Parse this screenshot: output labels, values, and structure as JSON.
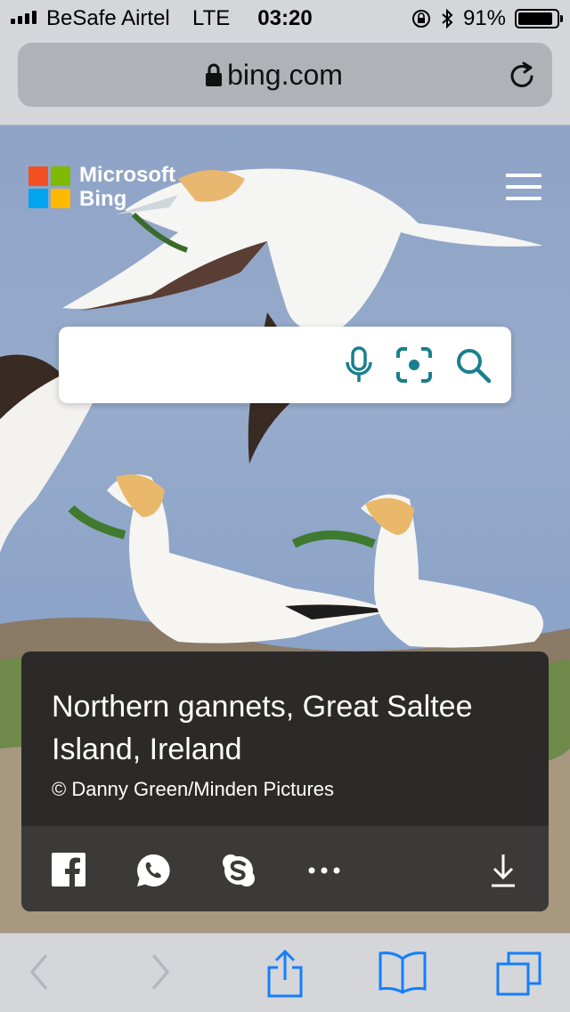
{
  "status_bar": {
    "carrier": "BeSafe Airtel",
    "network": "LTE",
    "time": "03:20",
    "battery": "91%",
    "battery_level": 0.91,
    "icons": [
      "signal-icon",
      "orientation-lock-icon",
      "bluetooth-icon",
      "battery-icon"
    ]
  },
  "browser": {
    "url": "bing.com",
    "icons": [
      "lock-icon",
      "reload-icon"
    ]
  },
  "bing": {
    "brand_line1": "Microsoft",
    "brand_line2": "Bing",
    "search_placeholder": "",
    "icons": [
      "microphone-icon",
      "visual-search-icon",
      "search-icon",
      "menu-icon"
    ],
    "logo_colors": [
      "#f25022",
      "#7fba00",
      "#00a4ef",
      "#ffb900"
    ],
    "accent": "#1a7f8e"
  },
  "caption": {
    "title": "Northern gannets, Great Saltee Island, Ireland",
    "credit": "© Danny Green/Minden Pictures",
    "share_icons": [
      "facebook-icon",
      "whatsapp-icon",
      "skype-icon",
      "more-icon",
      "download-icon"
    ]
  },
  "toolbar": {
    "icons": [
      "back-icon",
      "forward-icon",
      "share-icon",
      "bookmarks-icon",
      "tabs-icon"
    ],
    "accent": "#147efb"
  }
}
